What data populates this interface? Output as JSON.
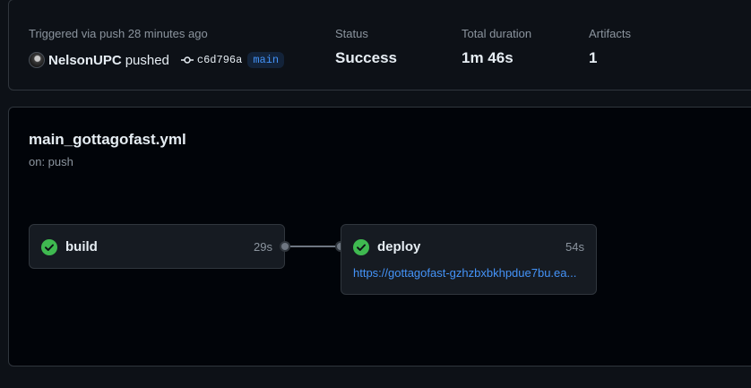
{
  "summary": {
    "trigger_text": "Triggered via push 28 minutes ago",
    "actor": "NelsonUPC",
    "action": "pushed",
    "commit_sha": "c6d796a",
    "branch": "main",
    "status_label": "Status",
    "status_value": "Success",
    "duration_label": "Total duration",
    "duration_value": "1m 46s",
    "artifacts_label": "Artifacts",
    "artifacts_value": "1"
  },
  "workflow": {
    "file_name": "main_gottagofast.yml",
    "trigger": "on: push",
    "jobs": [
      {
        "name": "build",
        "duration": "29s",
        "status": "success"
      },
      {
        "name": "deploy",
        "duration": "54s",
        "status": "success",
        "url": "https://gottagofast-gzhzbxbkhpdue7bu.ea..."
      }
    ]
  },
  "colors": {
    "success": "#3fb950",
    "link": "#4493f8",
    "background": "#0d1117"
  }
}
